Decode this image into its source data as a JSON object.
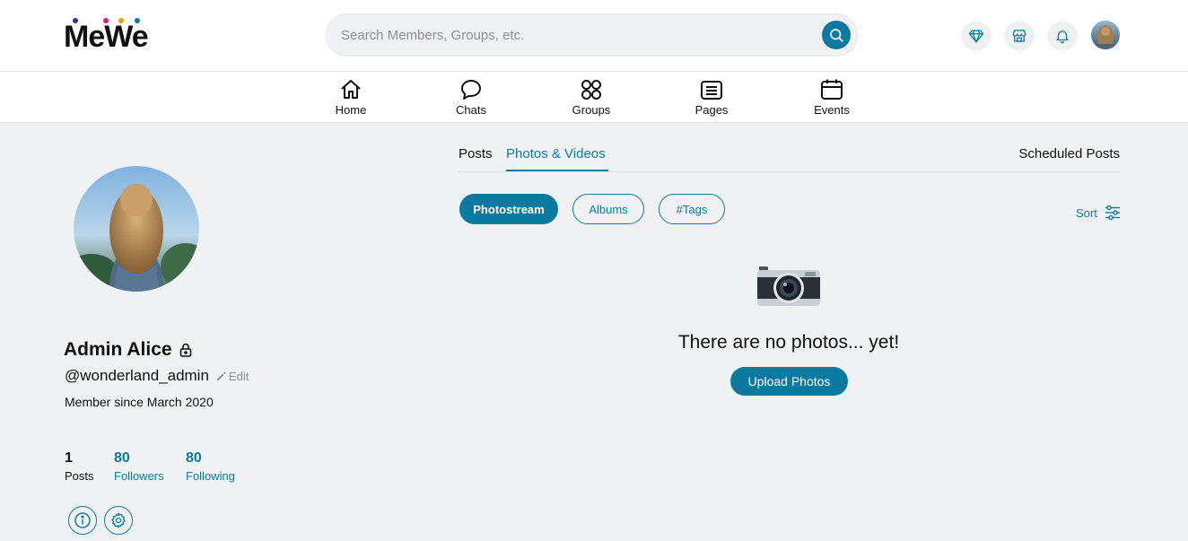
{
  "brand": {
    "name": "MeWe",
    "dot_colors": [
      "#1e3a8a",
      "#e3157b",
      "#f59e0b",
      "#0b7aa1"
    ],
    "accent": "#0b7aa1"
  },
  "header": {
    "search_placeholder": "Search Members, Groups, etc.",
    "icons": [
      "diamond-icon",
      "store-icon",
      "bell-icon"
    ]
  },
  "nav": {
    "items": [
      {
        "label": "Home",
        "icon": "home-icon"
      },
      {
        "label": "Chats",
        "icon": "chat-bubble-icon"
      },
      {
        "label": "Groups",
        "icon": "groups-icon"
      },
      {
        "label": "Pages",
        "icon": "pages-icon"
      },
      {
        "label": "Events",
        "icon": "calendar-icon"
      }
    ]
  },
  "profile": {
    "name": "Admin Alice",
    "handle": "@wonderland_admin",
    "edit_label": "Edit",
    "member_since": "Member since March 2020",
    "stats": [
      {
        "num": "1",
        "label": "Posts"
      },
      {
        "num": "80",
        "label": "Followers"
      },
      {
        "num": "80",
        "label": "Following"
      }
    ]
  },
  "tabs": {
    "posts": "Posts",
    "photos_videos": "Photos & Videos",
    "scheduled": "Scheduled Posts",
    "active": "Photos & Videos"
  },
  "filters": {
    "chips": [
      "Photostream",
      "Albums",
      "#Tags"
    ],
    "active": "Photostream",
    "sort_label": "Sort"
  },
  "empty_state": {
    "message": "There are no photos... yet!",
    "upload_label": "Upload Photos"
  }
}
